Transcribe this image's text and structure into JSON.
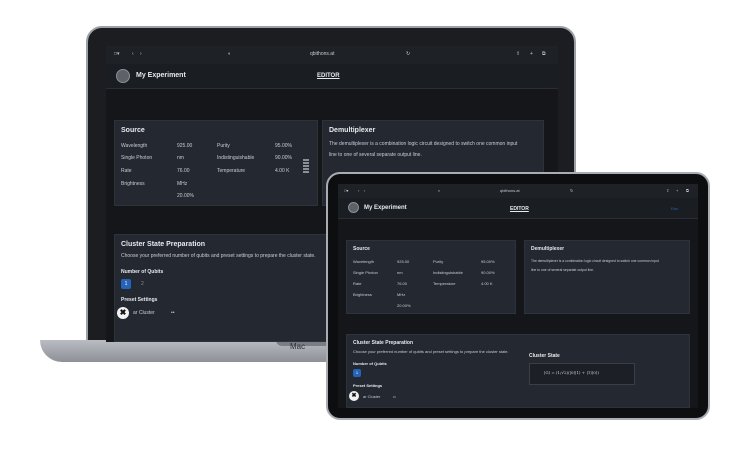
{
  "laptop": {
    "brand_label": "Mac",
    "url": "qbithons.at",
    "app_title": "My Experiment",
    "tab_editor": "EDITOR",
    "source": {
      "title": "Source",
      "rows": [
        {
          "label": "Wavelength",
          "value": "925.00"
        },
        {
          "label": "Single Photon",
          "value": "nm"
        },
        {
          "label": "Rate",
          "value": "76.00"
        },
        {
          "label": "Brightness",
          "value": "MHz"
        }
      ],
      "extra_value": "20.00%",
      "props": [
        {
          "label": "Purity",
          "value": "95.00%"
        },
        {
          "label": "Indistinguishable",
          "value": "90.00%"
        },
        {
          "label": "Temperature",
          "value": "4.00 K"
        }
      ]
    },
    "demux": {
      "title": "Demultiplexer",
      "description_1": "The demultiplexer is a combination logic circuit designed to switch one common input",
      "description_2": "line to one of several separate output line."
    },
    "cluster": {
      "title": "Cluster State Preparation",
      "description": "Choose your preferred number of qubits and preset settings to prepare the cluster state.",
      "qubits_label": "Number of Qubits",
      "qubits_value": "1",
      "qubits_next": "2",
      "preset_label": "Preset Settings",
      "preset_value": "ar Cluster",
      "preset_more": "••",
      "logo_glyph": "✖"
    }
  },
  "tablet": {
    "url": "qbithons.at",
    "app_title": "My Experiment",
    "tab_editor": "EDITOR",
    "right_link": "Run",
    "source": {
      "title": "Source",
      "rows": [
        {
          "label": "Wavelength",
          "value": "925.00"
        },
        {
          "label": "Single Photon",
          "value": "nm"
        },
        {
          "label": "Rate",
          "value": "76.00"
        },
        {
          "label": "Brightness",
          "value": "MHz"
        }
      ],
      "extra_value": "20.00%",
      "props": [
        {
          "label": "Purity",
          "value": "95.00%"
        },
        {
          "label": "Indistinguishable",
          "value": "90.00%"
        },
        {
          "label": "Temperature",
          "value": "4.00 K"
        }
      ]
    },
    "demux": {
      "title": "Demultiplexer",
      "description_1": "The demultiplexer is a combination logic circuit designed to switch one common input",
      "description_2": "line to one of several separate output line."
    },
    "cluster": {
      "title": "Cluster State Preparation",
      "description": "Choose your preferred number of qubits and preset settings to prepare the cluster state.",
      "qubits_label": "Number of Qubits",
      "qubits_value": "1",
      "preset_label": "Preset Settings",
      "preset_value": "ar Cluster",
      "preset_more": "••",
      "logo_glyph": "✖"
    },
    "cluster_state": {
      "title": "Cluster State",
      "equation": "|G⟩ = (1/√2)(|0⟩|1⟩ + |1⟩|0⟩)"
    }
  }
}
